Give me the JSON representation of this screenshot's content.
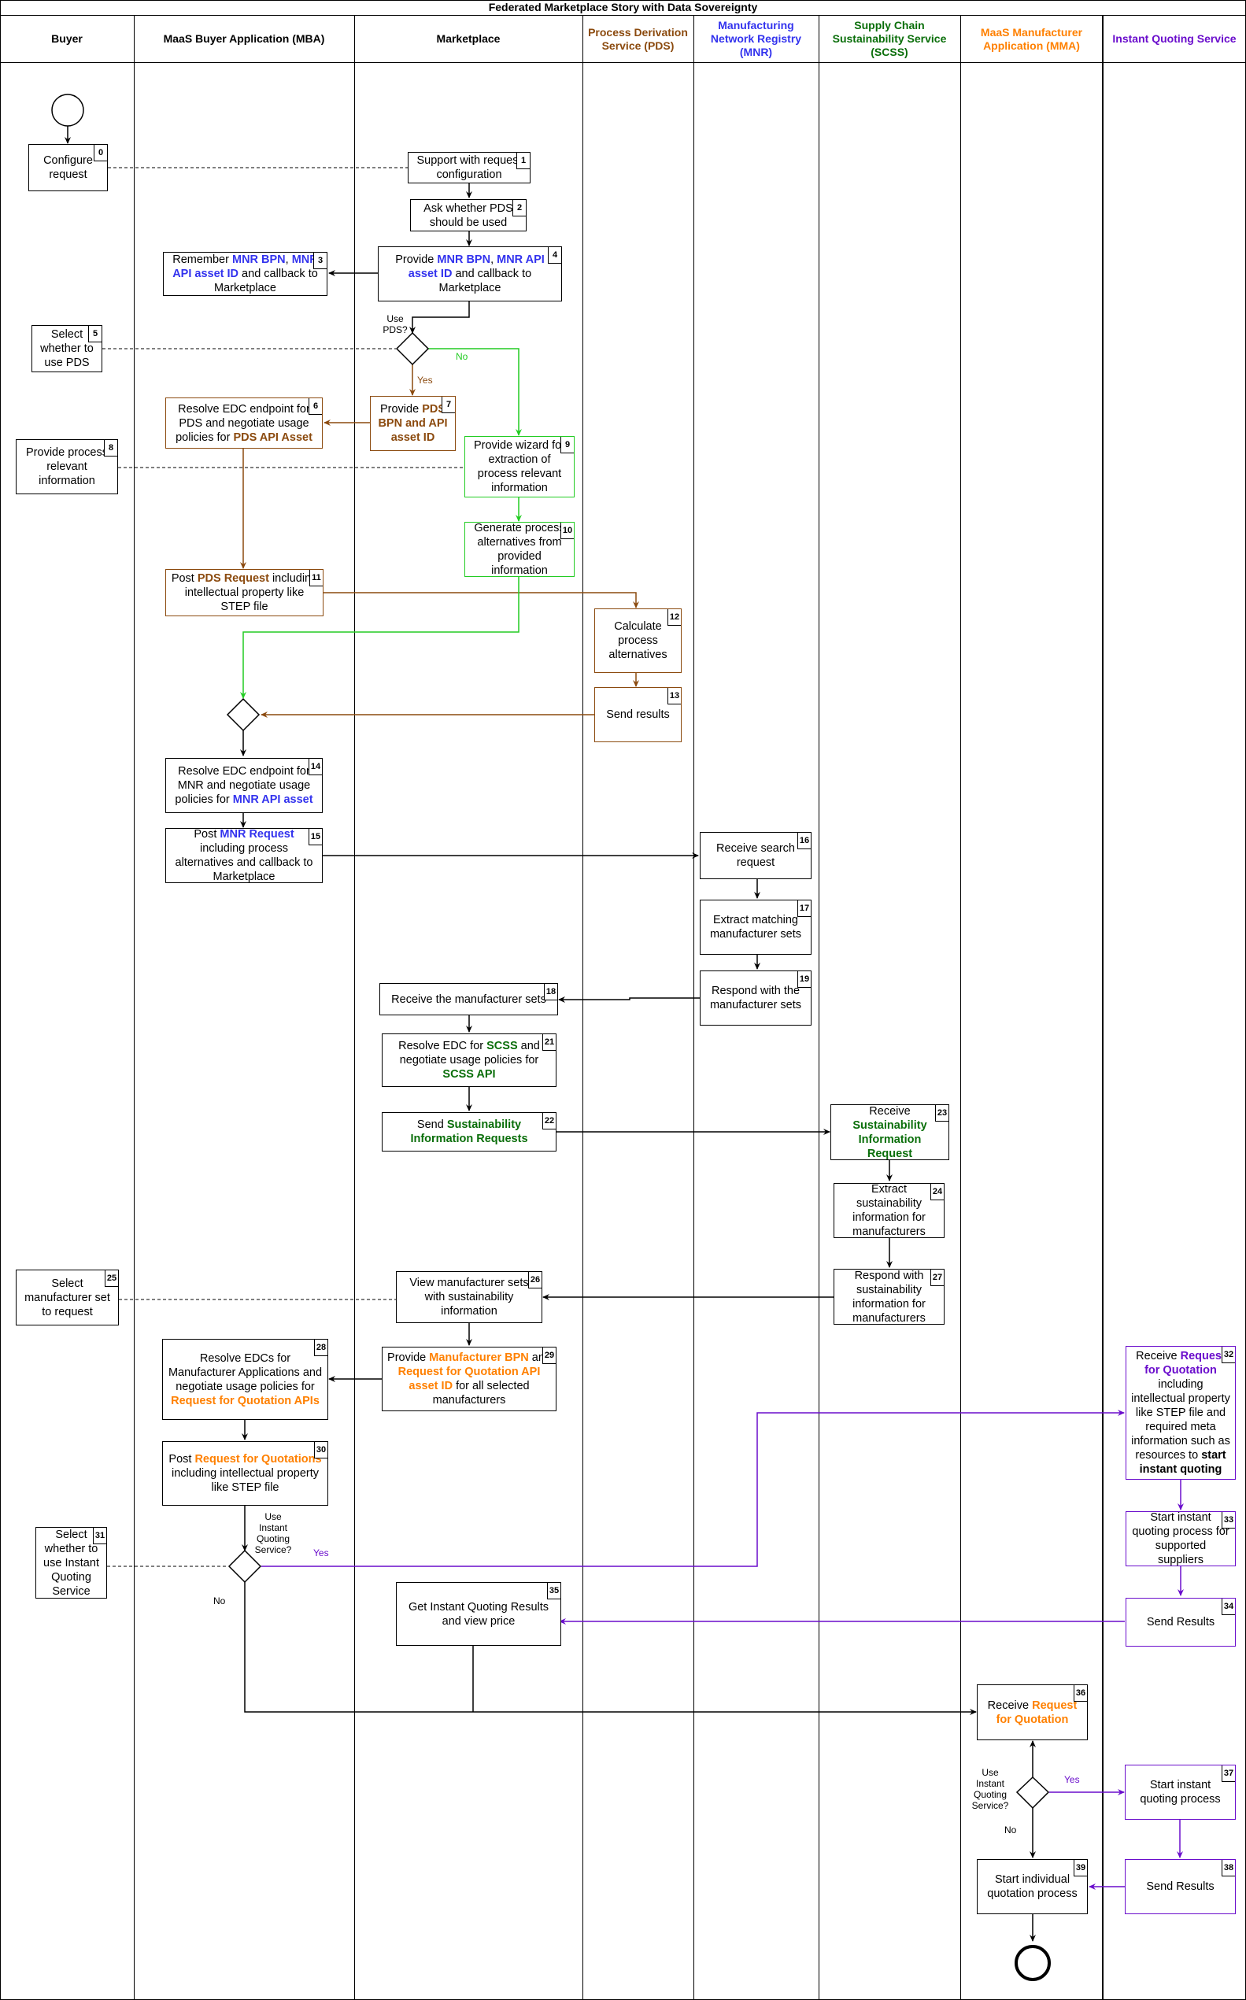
{
  "title": "Federated Marketplace Story with Data Sovereignty",
  "colors": {
    "pds": "#8B4A0E",
    "mnr": "#3333EE",
    "scss": "#0A6E0A",
    "mma": "#FF8000",
    "iqs": "#6A0DCC",
    "no_green": "#22CC22",
    "black": "#000000"
  },
  "lanes": [
    {
      "id": "buyer",
      "label": "Buyer",
      "color": "#000000"
    },
    {
      "id": "mba",
      "label": "MaaS Buyer Application (MBA)",
      "color": "#000000"
    },
    {
      "id": "marketplace",
      "label": "Marketplace",
      "color": "#000000"
    },
    {
      "id": "pds",
      "label": "Process Derivation Service (PDS)",
      "color": "#8B4A0E"
    },
    {
      "id": "mnr",
      "label": "Manufacturing Network Registry (MNR)",
      "color": "#3333EE"
    },
    {
      "id": "scss",
      "label": "Supply Chain Sustainability Service (SCSS)",
      "color": "#0A6E0A"
    },
    {
      "id": "mma",
      "label": "MaaS Manufacturer Application (MMA)",
      "color": "#FF8000"
    },
    {
      "id": "iqs",
      "label": "Instant Quoting Service",
      "color": "#6A0DCC"
    }
  ],
  "steps": [
    {
      "n": "0",
      "lane": "buyer",
      "text": [
        {
          "t": "Configure request"
        }
      ]
    },
    {
      "n": "1",
      "lane": "marketplace",
      "text": [
        {
          "t": "Support with request configuration"
        }
      ]
    },
    {
      "n": "2",
      "lane": "marketplace",
      "text": [
        {
          "t": "Ask whether PDS should be used"
        }
      ]
    },
    {
      "n": "3",
      "lane": "mba",
      "text": [
        {
          "t": "Remember "
        },
        {
          "t": "MNR BPN",
          "c": "mnr"
        },
        {
          "t": ", "
        },
        {
          "t": "MNR API asset ID",
          "c": "mnr"
        },
        {
          "t": " and callback to Marketplace"
        }
      ]
    },
    {
      "n": "4",
      "lane": "marketplace",
      "text": [
        {
          "t": "Provide "
        },
        {
          "t": "MNR BPN",
          "c": "mnr"
        },
        {
          "t": ", "
        },
        {
          "t": "MNR API asset ID",
          "c": "mnr"
        },
        {
          "t": " and callback to Marketplace"
        }
      ]
    },
    {
      "n": "5",
      "lane": "buyer",
      "text": [
        {
          "t": "Select whether to use PDS"
        }
      ]
    },
    {
      "n": "6",
      "lane": "mba",
      "text": [
        {
          "t": "Resolve EDC endpoint for PDS and negotiate usage policies for "
        },
        {
          "t": "PDS API Asset",
          "c": "pds"
        }
      ]
    },
    {
      "n": "7",
      "lane": "marketplace",
      "text": [
        {
          "t": "Provide "
        },
        {
          "t": "PDS BPN and API asset ID",
          "c": "pds"
        }
      ]
    },
    {
      "n": "8",
      "lane": "buyer",
      "text": [
        {
          "t": "Provide process relevant information"
        }
      ]
    },
    {
      "n": "9",
      "lane": "marketplace",
      "text": [
        {
          "t": "Provide wizard for extraction of process relevant information"
        }
      ]
    },
    {
      "n": "10",
      "lane": "marketplace",
      "text": [
        {
          "t": "Generate process alternatives from provided information"
        }
      ]
    },
    {
      "n": "11",
      "lane": "mba",
      "text": [
        {
          "t": "Post "
        },
        {
          "t": "PDS Request",
          "c": "pds"
        },
        {
          "t": " including intellectual property like STEP file"
        }
      ]
    },
    {
      "n": "12",
      "lane": "pds",
      "text": [
        {
          "t": "Calculate process alternatives"
        }
      ]
    },
    {
      "n": "13",
      "lane": "pds",
      "text": [
        {
          "t": "Send results"
        }
      ]
    },
    {
      "n": "14",
      "lane": "mba",
      "text": [
        {
          "t": "Resolve EDC endpoint for MNR and negotiate usage policies for "
        },
        {
          "t": "MNR API asset",
          "c": "mnr"
        }
      ]
    },
    {
      "n": "15",
      "lane": "mba",
      "text": [
        {
          "t": "Post "
        },
        {
          "t": "MNR Request",
          "c": "mnr"
        },
        {
          "t": " including process alternatives and callback to Marketplace"
        }
      ]
    },
    {
      "n": "16",
      "lane": "mnr",
      "text": [
        {
          "t": "Receive search request"
        }
      ]
    },
    {
      "n": "17",
      "lane": "mnr",
      "text": [
        {
          "t": "Extract matching manufacturer sets"
        }
      ]
    },
    {
      "n": "18",
      "lane": "marketplace",
      "text": [
        {
          "t": "Receive the manufacturer sets"
        }
      ]
    },
    {
      "n": "19",
      "lane": "mnr",
      "text": [
        {
          "t": "Respond with the manufacturer sets"
        }
      ]
    },
    {
      "n": "21",
      "lane": "marketplace",
      "text": [
        {
          "t": "Resolve EDC for "
        },
        {
          "t": "SCSS",
          "c": "scss"
        },
        {
          "t": " and negotiate usage policies for "
        },
        {
          "t": "SCSS API",
          "c": "scss"
        }
      ]
    },
    {
      "n": "22",
      "lane": "marketplace",
      "text": [
        {
          "t": "Send "
        },
        {
          "t": "Sustainability Information Requests",
          "c": "scss"
        }
      ]
    },
    {
      "n": "23",
      "lane": "scss",
      "text": [
        {
          "t": "Receive "
        },
        {
          "t": "Sustainability Information Request",
          "c": "scss"
        }
      ]
    },
    {
      "n": "24",
      "lane": "scss",
      "text": [
        {
          "t": "Extract sustainability information for manufacturers"
        }
      ]
    },
    {
      "n": "25",
      "lane": "buyer",
      "text": [
        {
          "t": "Select manufacturer set to request"
        }
      ]
    },
    {
      "n": "26",
      "lane": "marketplace",
      "text": [
        {
          "t": "View manufacturer sets with sustainability information"
        }
      ]
    },
    {
      "n": "27",
      "lane": "scss",
      "text": [
        {
          "t": "Respond with sustainability information for manufacturers"
        }
      ]
    },
    {
      "n": "28",
      "lane": "mba",
      "text": [
        {
          "t": "Resolve EDCs for Manufacturer Applications and negotiate usage policies for "
        },
        {
          "t": "Request for Quotation APIs",
          "c": "mma"
        }
      ]
    },
    {
      "n": "29",
      "lane": "marketplace",
      "text": [
        {
          "t": "Provide "
        },
        {
          "t": "Manufacturer BPN",
          "c": "mma"
        },
        {
          "t": " and "
        },
        {
          "t": "Request for Quotation API asset ID",
          "c": "mma"
        },
        {
          "t": " for all selected manufacturers"
        }
      ]
    },
    {
      "n": "30",
      "lane": "mba",
      "text": [
        {
          "t": "Post "
        },
        {
          "t": "Request for Quotations",
          "c": "mma"
        },
        {
          "t": " including intellectual property like STEP file"
        }
      ]
    },
    {
      "n": "31",
      "lane": "buyer",
      "text": [
        {
          "t": "Select whether to use Instant Quoting Service"
        }
      ]
    },
    {
      "n": "32",
      "lane": "iqs",
      "text": [
        {
          "t": "Receive "
        },
        {
          "t": "Request for Quotation",
          "c": "iqs"
        },
        {
          "t": " including intellectual property like STEP file and required meta information such as resources to "
        },
        {
          "t": "start instant quoting",
          "c": "black"
        }
      ]
    },
    {
      "n": "33",
      "lane": "iqs",
      "text": [
        {
          "t": "Start instant quoting process for supported suppliers"
        }
      ]
    },
    {
      "n": "34",
      "lane": "iqs",
      "text": [
        {
          "t": "Send Results"
        }
      ]
    },
    {
      "n": "35",
      "lane": "marketplace",
      "text": [
        {
          "t": "Get Instant Quoting Results and view price"
        }
      ]
    },
    {
      "n": "36",
      "lane": "mma",
      "text": [
        {
          "t": "Receive "
        },
        {
          "t": "Request for Quotation",
          "c": "mma"
        }
      ]
    },
    {
      "n": "37",
      "lane": "iqs",
      "text": [
        {
          "t": "Start instant quoting process"
        }
      ]
    },
    {
      "n": "38",
      "lane": "iqs",
      "text": [
        {
          "t": "Send Results"
        }
      ]
    },
    {
      "n": "39",
      "lane": "mma",
      "text": [
        {
          "t": "Start individual quotation process"
        }
      ]
    }
  ],
  "decisions": {
    "use_pds": {
      "question": "Use PDS?",
      "yes": "Yes",
      "no": "No"
    },
    "use_iqs_mba": {
      "question": "Use Instant Quoting Service?",
      "yes": "Yes",
      "no": "No"
    },
    "use_iqs_mma": {
      "question": "Use Instant Quoting Service?",
      "yes": "Yes",
      "no": "No"
    }
  }
}
